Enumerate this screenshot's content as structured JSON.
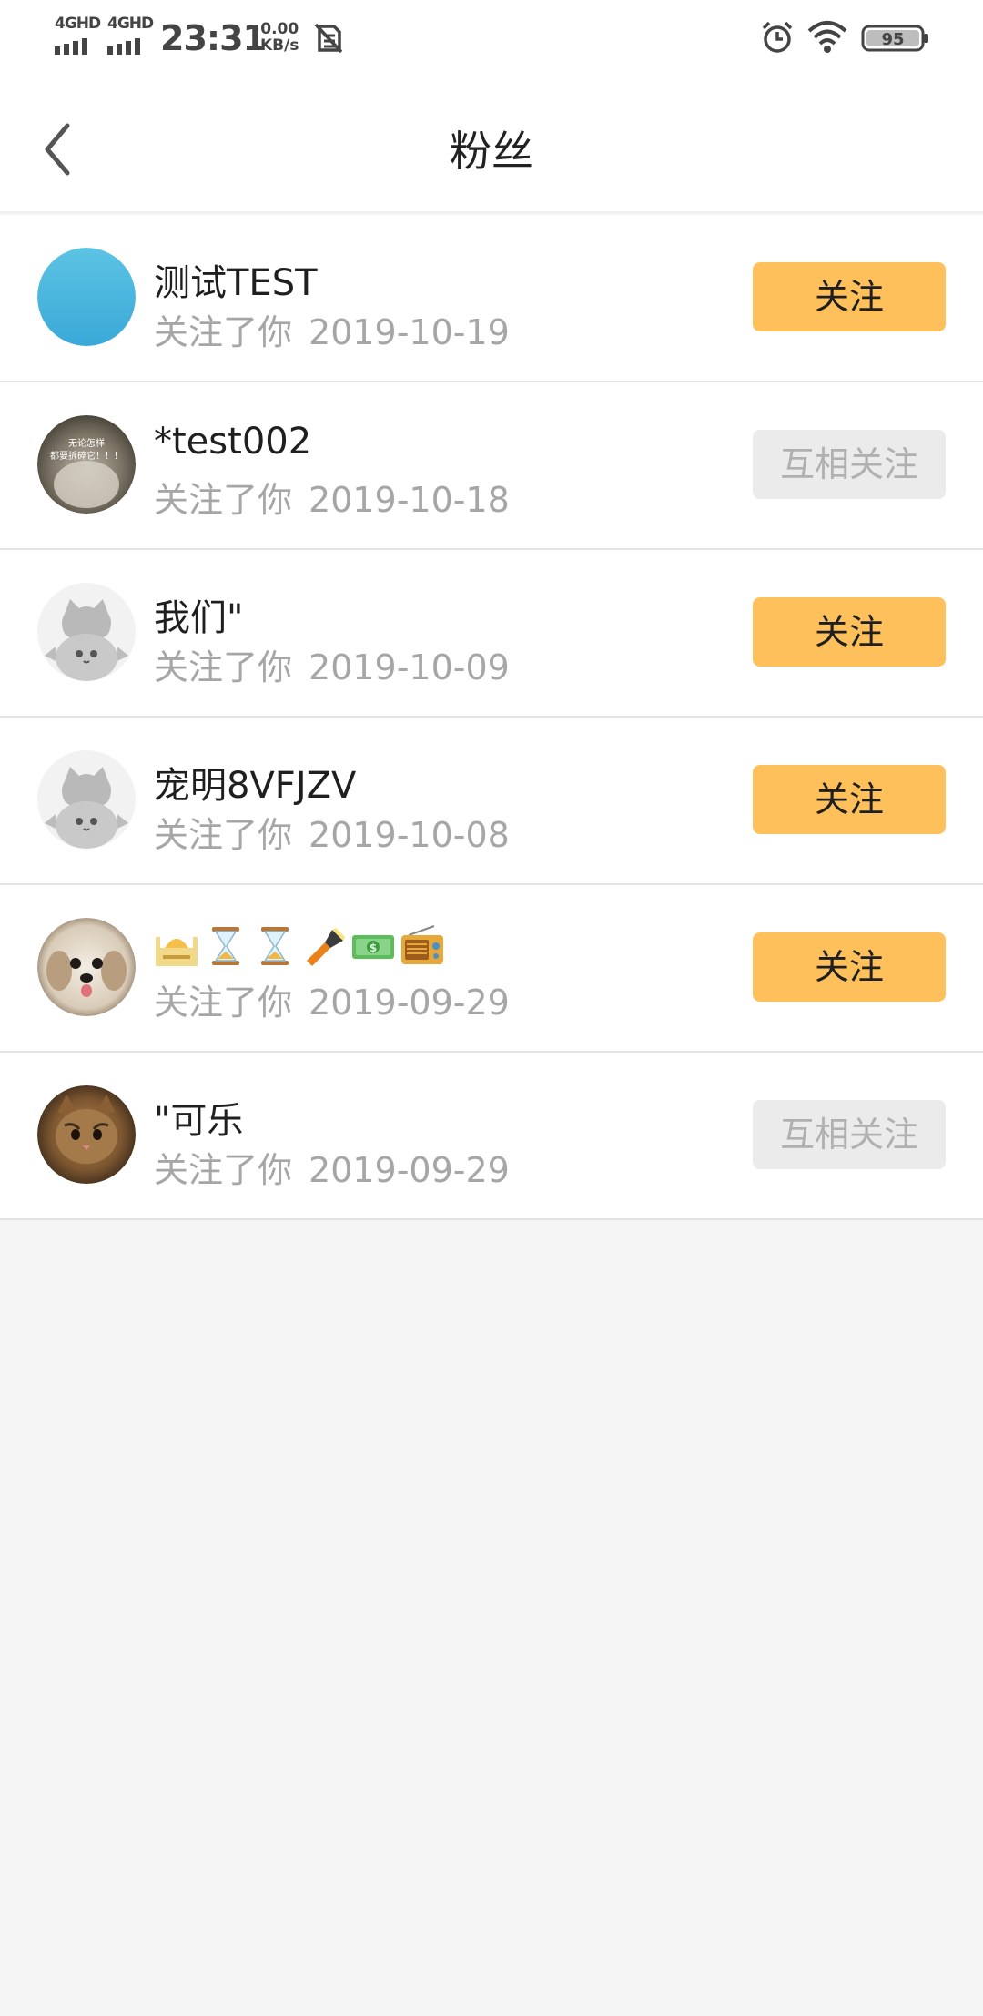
{
  "status_bar": {
    "network_1": "4GHD",
    "network_2": "4GHD",
    "time": "23:31",
    "speed_value": "0.00",
    "speed_unit": "KB/s",
    "battery": "95",
    "icons": [
      "signal-icon",
      "signal-icon",
      "no-sim-icon",
      "alarm-icon",
      "wifi-icon",
      "battery-icon"
    ]
  },
  "header": {
    "title": "粉丝",
    "back_icon": "chevron-left-icon"
  },
  "colors": {
    "follow_button_bg": "#fdc05b",
    "mutual_button_bg": "#ebebeb",
    "background": "#f5f5f5"
  },
  "fans": [
    {
      "name": "测试TEST",
      "subtitle": "关注了你",
      "date": "2019-10-19",
      "button": "关注",
      "button_state": "follow",
      "avatar": "blue-circle-avatar"
    },
    {
      "name": "*test002",
      "subtitle": "关注了你",
      "date": "2019-10-18",
      "button": "互相关注",
      "button_state": "mutual",
      "avatar": "photo-avatar",
      "avatar_text_1": "无论怎样",
      "avatar_text_2": "都要拆碎它！！！"
    },
    {
      "name": "我们\"",
      "subtitle": "关注了你",
      "date": "2019-10-09",
      "button": "关注",
      "button_state": "follow",
      "avatar": "default-cat-avatar"
    },
    {
      "name": "宠明8VFJZV",
      "subtitle": "关注了你",
      "date": "2019-10-08",
      "button": "关注",
      "button_state": "follow",
      "avatar": "default-cat-avatar"
    },
    {
      "name": "🕌⌛⌛🔦💵📻",
      "subtitle": "关注了你",
      "date": "2019-09-29",
      "button": "关注",
      "button_state": "follow",
      "avatar": "dog-photo-avatar",
      "name_icons": [
        "mosque-icon",
        "hourglass-icon",
        "hourglass-icon",
        "flashlight-icon",
        "dollar-banknote-icon",
        "radio-icon"
      ]
    },
    {
      "name": "\"可乐",
      "subtitle": "关注了你",
      "date": "2019-09-29",
      "button": "互相关注",
      "button_state": "mutual",
      "avatar": "cat-photo-avatar"
    }
  ]
}
